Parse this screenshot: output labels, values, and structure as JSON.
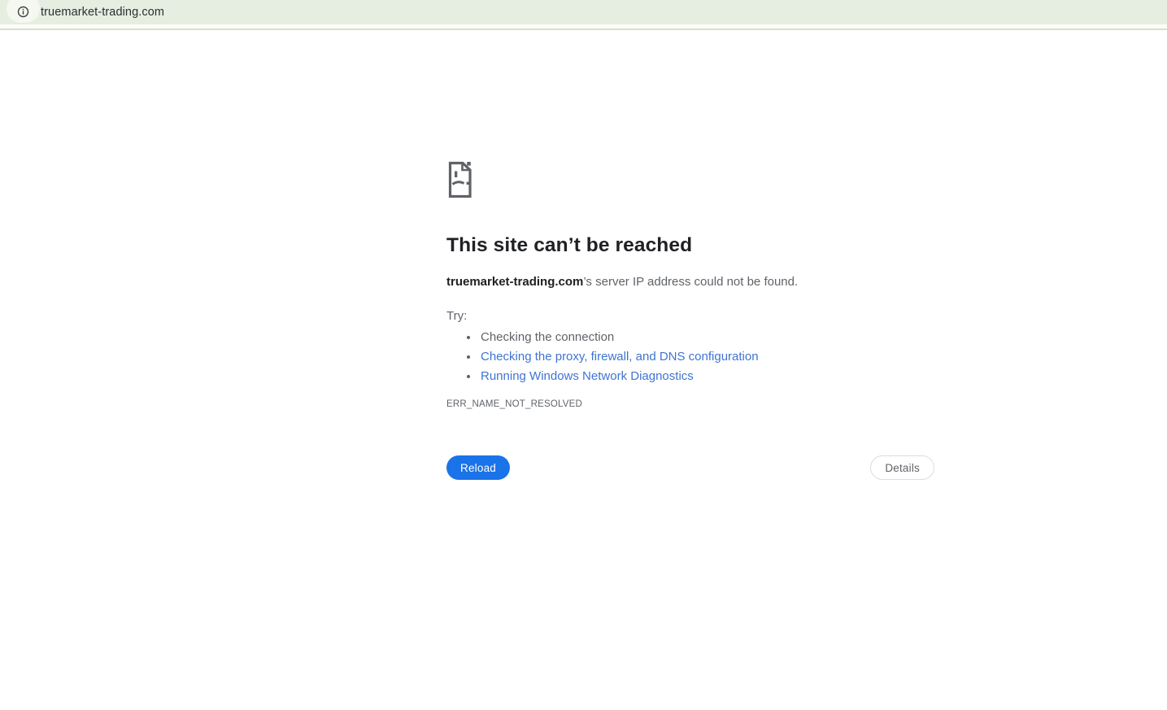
{
  "browser": {
    "url": "truemarket-trading.com",
    "info_icon": "info-icon"
  },
  "error_page": {
    "sad_file_icon": "sad-file-icon",
    "title": "This site can’t be reached",
    "domain": "truemarket-trading.com",
    "message_rest": "’s server IP address could not be found.",
    "try_label": "Try:",
    "suggestions": [
      {
        "label": "Checking the connection",
        "is_link": false
      },
      {
        "label": "Checking the proxy, firewall, and DNS configuration",
        "is_link": true
      },
      {
        "label": "Running Windows Network Diagnostics",
        "is_link": true
      }
    ],
    "error_code": "ERR_NAME_NOT_RESOLVED",
    "reload_label": "Reload",
    "details_label": "Details"
  },
  "colors": {
    "address_bar_bg": "#e5eee1",
    "chip_bg": "#f4f8f0",
    "strip_bg": "#fbfdf6",
    "strip_border": "#d9ddd0",
    "title_text": "#202124",
    "body_text": "#5f6368",
    "link_blue": "#3f74d1",
    "primary_button_bg": "#1a73e8",
    "primary_button_text": "#ffffff",
    "secondary_button_border": "#dadce0",
    "icon_gray": "#5f6368"
  }
}
